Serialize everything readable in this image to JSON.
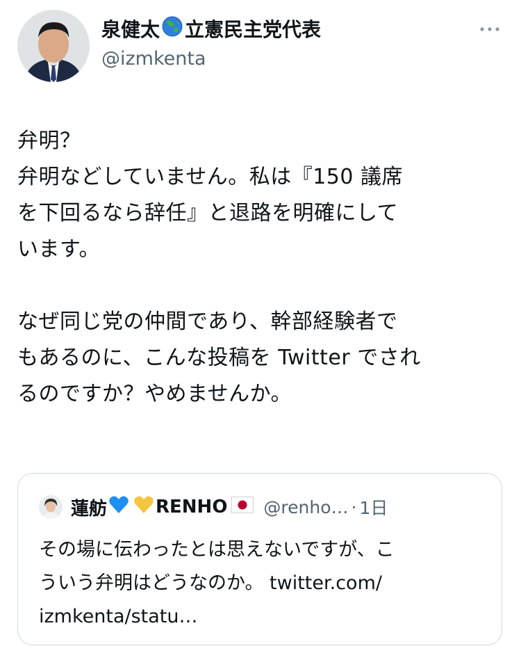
{
  "author": {
    "name_part1": "泉健太",
    "name_part2": "立憲民主党代表",
    "handle": "@izmkenta"
  },
  "tweet": {
    "text": "弁明？\n弁明などしていません。私は『150 議席\nを下回るなら辞任』と退路を明確にして\nいます。\n\nなぜ同じ党の仲間であり、幹部経験者で\nもあるのに、こんな投稿を Twitter でされ\nるのですか？やめませんか。"
  },
  "quote": {
    "name_part1": "蓮舫",
    "name_part2": "RENHO",
    "handle": "@renho…",
    "dot": "·",
    "time": "1日",
    "text": "その場に伝わったとは思えないですが、こ\nういう弁明はどうなのか。 twitter.com/\nizmkenta/statu…"
  },
  "icons": {
    "globe": "globe-asia-icon",
    "blue_heart": "blue-heart-icon",
    "yellow_heart": "yellow-heart-icon",
    "japan_flag": "japan-flag-icon",
    "more": "more-horizontal-icon"
  },
  "colors": {
    "text": "#0f1419",
    "secondary": "#536471",
    "border": "#cfd9de",
    "heart_blue": "#1d8ff0",
    "heart_yellow": "#f5c542",
    "flag_red": "#bc002d"
  }
}
